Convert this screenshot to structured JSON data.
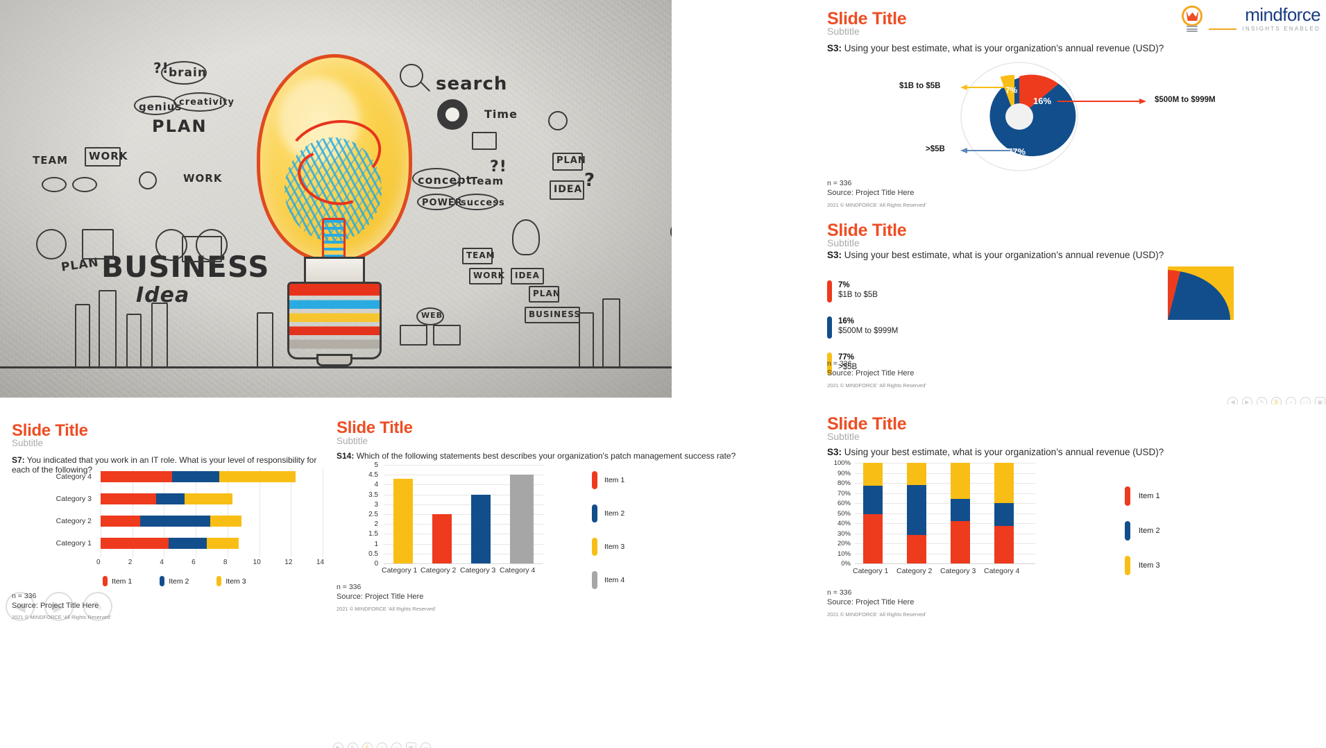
{
  "brand": {
    "logo_word": "mindforce",
    "logo_tagline": "INSIGHTS ENABLED",
    "accent_orange": "#EE4D23",
    "accent_blue": "#124E8C",
    "accent_yellow": "#F9BE16",
    "accent_gray": "#A6A6A6",
    "logo_bulb_icon": "lightbulb-icon"
  },
  "photo": {
    "alt": "business idea lightbulb doodle wall photo",
    "words": {
      "brain": "brain",
      "genius": "genius",
      "creativity": "creativity",
      "plan": "PLAN",
      "work_top": "WORK",
      "team": "TEAM",
      "work_left": "WORK",
      "search": "search",
      "time": "Time",
      "concept": "concept",
      "team2": "Team",
      "power": "POWER",
      "success": "success",
      "plan2": "PLAN",
      "idea": "IDEA",
      "business_big": "BUSINESS",
      "idea_script": "Idea",
      "plan3": "PLAN",
      "team3": "TEAM",
      "work2": "WORK",
      "idea2": "IDEA",
      "plan4": "PLAN",
      "business2": "BUSINESS",
      "web": "WEB",
      "q1": "?!",
      "q2": "?!",
      "q3": "?"
    }
  },
  "slides": [
    {
      "id": "slide-donut",
      "title": "Slide Title",
      "subtitle": "Subtitle",
      "question_code": "S3:",
      "question_text": " Using your best estimate, what is your organization’s annual revenue (USD)?",
      "footer": {
        "n_label": "n =",
        "n_value": "336",
        "source": "Source: Project Title Here",
        "copyright": "2021 © MINDFORCE ‘All Rights Reserved’"
      },
      "chart_data": {
        "type": "pie",
        "variant": "donut-exploded",
        "title": "",
        "labels": [
          "$1B to $5B",
          "$500M to $999M",
          ">$5B"
        ],
        "values": [
          7,
          16,
          77
        ],
        "value_labels": [
          "7%",
          "16%",
          "77%"
        ],
        "colors": [
          "#F9BE16",
          "#EE3A1D",
          "#124E8C"
        ],
        "callouts": [
          {
            "label": "$1B to $5B",
            "side": "left",
            "color": "#F9BE16"
          },
          {
            "label": "$500M to $999M",
            "side": "right",
            "color": "#EE3A1D"
          },
          {
            "label": ">$5B",
            "side": "left",
            "color": "#5B86B8"
          }
        ],
        "legend": "callout",
        "grid": false
      }
    },
    {
      "id": "slide-pie",
      "title": "Slide Title",
      "subtitle": "Subtitle",
      "question_code": "S3:",
      "question_text": " Using your best estimate, what is your organization’s annual revenue (USD)?",
      "footer": {
        "n_label": "n =",
        "n_value": "336",
        "source": "Source: Project Title Here",
        "copyright": "2021 © MINDFORCE ‘All Rights Reserved’"
      },
      "chart_data": {
        "type": "pie",
        "variant": "full-pie",
        "title": "",
        "labels": [
          "$1B to $5B",
          "$500M to $999M",
          ">$5B"
        ],
        "values": [
          7,
          16,
          77
        ],
        "value_labels": [
          "7%",
          "16%",
          "77%"
        ],
        "colors": [
          "#EE3A1D",
          "#124E8C",
          "#F9BE16"
        ],
        "legend": "left",
        "grid": false
      }
    },
    {
      "id": "slide-hbar",
      "title": "Slide Title",
      "subtitle": "Subtitle",
      "question_code": "S7:",
      "question_text": " You indicated that you work in an IT role. What is your level of responsibility for each of the following?",
      "footer": {
        "n_label": "n =",
        "n_value": "336",
        "source": "Source: Project Title Here",
        "copyright": "2021 © MINDFORCE ‘All Rights Reserved’"
      },
      "chart_data": {
        "type": "bar",
        "variant": "horizontal-stacked",
        "title": "",
        "categories": [
          "Category 1",
          "Category 2",
          "Category 3",
          "Category 4"
        ],
        "series": [
          {
            "name": "Item 1",
            "color": "#EE3A1D",
            "values": [
              4.3,
              2.5,
              3.5,
              4.5
            ]
          },
          {
            "name": "Item 2",
            "color": "#124E8C",
            "values": [
              2.4,
              4.4,
              1.8,
              3.0
            ]
          },
          {
            "name": "Item 3",
            "color": "#F9BE16",
            "values": [
              2.0,
              2.0,
              3.0,
              4.8
            ]
          }
        ],
        "xlabel": "",
        "ylabel": "",
        "xticks": [
          "0",
          "2",
          "4",
          "6",
          "8",
          "10",
          "12",
          "14"
        ],
        "xlim": [
          0,
          14
        ],
        "grid": true,
        "legend_position": "bottom"
      }
    },
    {
      "id": "slide-vbar",
      "title": "Slide Title",
      "subtitle": "Subtitle",
      "question_code": "S14:",
      "question_text": " Which of the following statements best describes your organization's patch management success rate?",
      "footer": {
        "n_label": "n =",
        "n_value": "336",
        "source": "Source: Project Title Here",
        "copyright": "2021 © MINDFORCE ‘All Rights Reserved’"
      },
      "chart_data": {
        "type": "bar",
        "variant": "vertical-grouped",
        "title": "",
        "categories": [
          "Category 1",
          "Category 2",
          "Category 3",
          "Category 4"
        ],
        "values": [
          4.3,
          2.5,
          3.5,
          4.5
        ],
        "bar_colors": [
          "#F9BE16",
          "#EE3A1D",
          "#124E8C",
          "#A6A6A6"
        ],
        "legend_items": [
          {
            "name": "Item 1",
            "color": "#EE3A1D"
          },
          {
            "name": "Item 2",
            "color": "#124E8C"
          },
          {
            "name": "Item 3",
            "color": "#F9BE16"
          },
          {
            "name": "Item 4",
            "color": "#A6A6A6"
          }
        ],
        "yticks": [
          "5",
          "4.5",
          "4",
          "3.5",
          "3",
          "2.5",
          "2",
          "1.5",
          "1",
          "0.5",
          "0"
        ],
        "ylim": [
          0,
          5
        ],
        "xlabel": "",
        "ylabel": "",
        "grid": true,
        "legend_position": "right"
      }
    },
    {
      "id": "slide-stacked100",
      "title": "Slide Title",
      "subtitle": "Subtitle",
      "question_code": "S3:",
      "question_text": " Using your best estimate, what is your organization’s annual revenue (USD)?",
      "footer": {
        "n_label": "n =",
        "n_value": "336",
        "source": "Source: Project Title Here",
        "copyright": "2021 © MINDFORCE ‘All Rights Reserved’"
      },
      "chart_data": {
        "type": "bar",
        "variant": "vertical-100-stacked",
        "title": "",
        "categories": [
          "Category 1",
          "Category 2",
          "Category 3",
          "Category 4"
        ],
        "series": [
          {
            "name": "Item 1",
            "color": "#EE3A1D",
            "values": [
              49,
              28,
              42,
              37
            ]
          },
          {
            "name": "Item 2",
            "color": "#124E8C",
            "values": [
              28,
              50,
              22,
              23
            ]
          },
          {
            "name": "Item 3",
            "color": "#F9BE16",
            "values": [
              23,
              22,
              36,
              40
            ]
          }
        ],
        "yticks": [
          "100%",
          "90%",
          "80%",
          "70%",
          "60%",
          "50%",
          "40%",
          "30%",
          "20%",
          "10%",
          "0%"
        ],
        "ylim": [
          0,
          100
        ],
        "xlabel": "",
        "ylabel": "",
        "grid": true,
        "legend_position": "right"
      }
    }
  ],
  "overlay_icons": {
    "bottom_left": [
      "prev-icon",
      "play-icon",
      "pen-icon"
    ],
    "bottom_center": [
      "play-icon",
      "pen-icon",
      "hand-icon",
      "search-icon",
      "note-icon",
      "camera-icon",
      "minus-icon"
    ],
    "right_panel": [
      "prev-icon",
      "play-icon",
      "pen-icon",
      "hand-icon",
      "search-icon",
      "note-icon",
      "camera-icon",
      "minus-icon"
    ]
  }
}
